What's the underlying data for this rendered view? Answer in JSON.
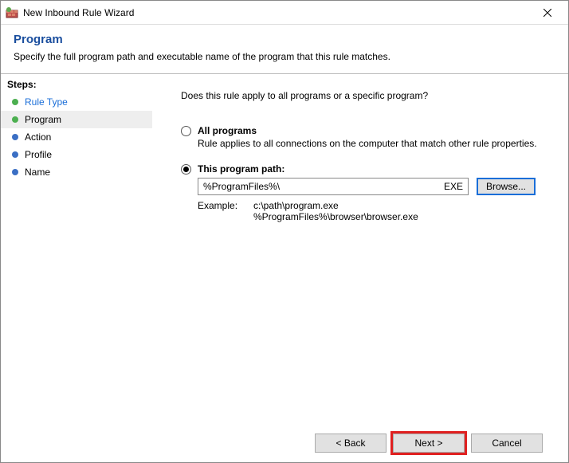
{
  "window": {
    "title": "New Inbound Rule Wizard"
  },
  "header": {
    "page_title": "Program",
    "page_desc": "Specify the full program path and executable name of the program that this rule matches."
  },
  "sidebar": {
    "heading": "Steps:",
    "items": [
      {
        "label": "Rule Type",
        "bullet": "green",
        "link": true,
        "current": false
      },
      {
        "label": "Program",
        "bullet": "green",
        "link": false,
        "current": true
      },
      {
        "label": "Action",
        "bullet": "blue",
        "link": false,
        "current": false
      },
      {
        "label": "Profile",
        "bullet": "blue",
        "link": false,
        "current": false
      },
      {
        "label": "Name",
        "bullet": "blue",
        "link": false,
        "current": false
      }
    ]
  },
  "content": {
    "prompt": "Does this rule apply to all programs or a specific program?",
    "option_all": {
      "label": "All programs",
      "sub": "Rule applies to all connections on the computer that match other rule properties.",
      "checked": false
    },
    "option_path": {
      "label": "This program path:",
      "checked": true,
      "input_value": "%ProgramFiles%\\",
      "input_ext": "EXE",
      "browse_label": "Browse...",
      "example_label": "Example:",
      "example_paths": "c:\\path\\program.exe\n%ProgramFiles%\\browser\\browser.exe"
    }
  },
  "footer": {
    "back_label": "< Back",
    "next_label": "Next >",
    "cancel_label": "Cancel"
  }
}
